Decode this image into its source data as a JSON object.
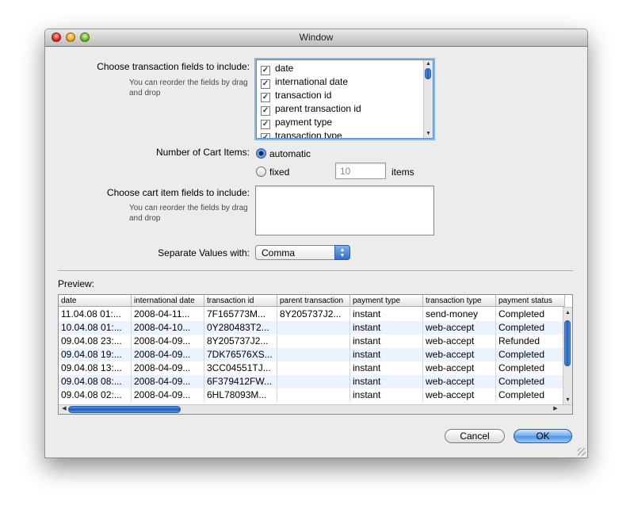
{
  "window": {
    "title": "Window"
  },
  "transaction_fields": {
    "label": "Choose transaction fields to include:",
    "hint": "You can reorder the fields by drag and drop",
    "items": [
      {
        "label": "date",
        "checked": true
      },
      {
        "label": "international date",
        "checked": true
      },
      {
        "label": "transaction id",
        "checked": true
      },
      {
        "label": "parent transaction id",
        "checked": true
      },
      {
        "label": "payment type",
        "checked": true
      },
      {
        "label": "transaction type",
        "checked": true
      }
    ]
  },
  "cart_items": {
    "label": "Number of Cart Items:",
    "automatic_label": "automatic",
    "fixed_label": "fixed",
    "fixed_value": "10",
    "items_label": "items",
    "selected": "automatic"
  },
  "cart_item_fields": {
    "label": "Choose cart item fields to include:",
    "hint": "You can reorder the fields by drag and drop"
  },
  "separator": {
    "label": "Separate Values with:",
    "value": "Comma"
  },
  "preview": {
    "label": "Preview:",
    "columns": [
      "date",
      "international date",
      "transaction id",
      "parent transaction",
      "payment type",
      "transaction type",
      "payment status"
    ],
    "rows": [
      [
        "11.04.08 01:...",
        "2008-04-11...",
        "7F165773M...",
        "8Y205737J2...",
        "instant",
        "send-money",
        "Completed"
      ],
      [
        "10.04.08 01:...",
        "2008-04-10...",
        "0Y280483T2...",
        "",
        "instant",
        "web-accept",
        "Completed"
      ],
      [
        "09.04.08 23:...",
        "2008-04-09...",
        "8Y205737J2...",
        "",
        "instant",
        "web-accept",
        "Refunded"
      ],
      [
        "09.04.08 19:...",
        "2008-04-09...",
        "7DK76576XS...",
        "",
        "instant",
        "web-accept",
        "Completed"
      ],
      [
        "09.04.08 13:...",
        "2008-04-09...",
        "3CC04551TJ...",
        "",
        "instant",
        "web-accept",
        "Completed"
      ],
      [
        "09.04.08 08:...",
        "2008-04-09...",
        "6F379412FW...",
        "",
        "instant",
        "web-accept",
        "Completed"
      ],
      [
        "09.04.08 02:...",
        "2008-04-09...",
        "6HL78093M...",
        "",
        "instant",
        "web-accept",
        "Completed"
      ]
    ]
  },
  "buttons": {
    "cancel": "Cancel",
    "ok": "OK"
  },
  "colors": {
    "accent": "#3f78c9",
    "row_alt": "#edf3fe"
  }
}
